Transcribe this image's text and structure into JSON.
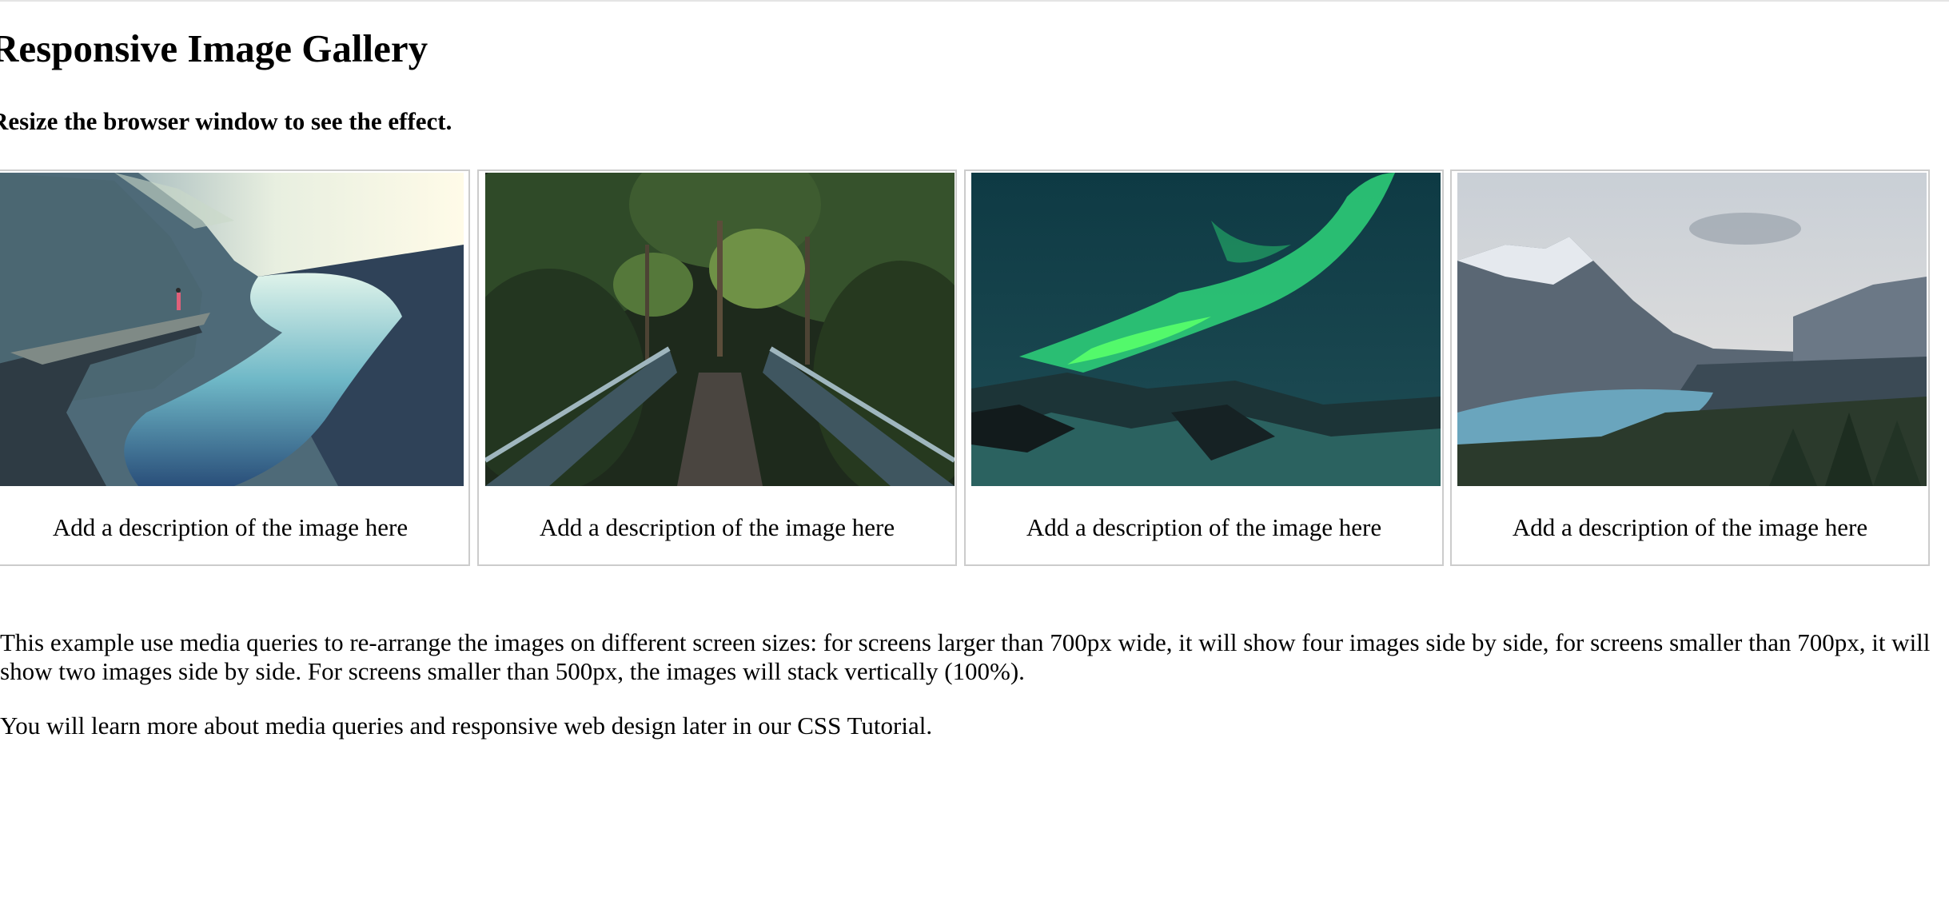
{
  "page": {
    "title": "Responsive Image Gallery",
    "subtitle": "Resize the browser window to see the effect."
  },
  "gallery": [
    {
      "image": "cliff-fjord-photo",
      "description": "Add a description of the image here"
    },
    {
      "image": "forest-bridge-photo",
      "description": "Add a description of the image here"
    },
    {
      "image": "northern-lights-photo",
      "description": "Add a description of the image here"
    },
    {
      "image": "mountain-lake-photo",
      "description": "Add a description of the image here"
    }
  ],
  "body": {
    "paragraph1": "This example use media queries to re-arrange the images on different screen sizes: for screens larger than 700px wide, it will show four images side by side, for screens smaller than 700px, it will show two images side by side. For screens smaller than 500px, the images will stack vertically (100%).",
    "paragraph2": "You will learn more about media queries and responsive web design later in our CSS Tutorial."
  },
  "colors": {
    "border": "#cccccc",
    "text": "#000000",
    "background": "#ffffff"
  }
}
